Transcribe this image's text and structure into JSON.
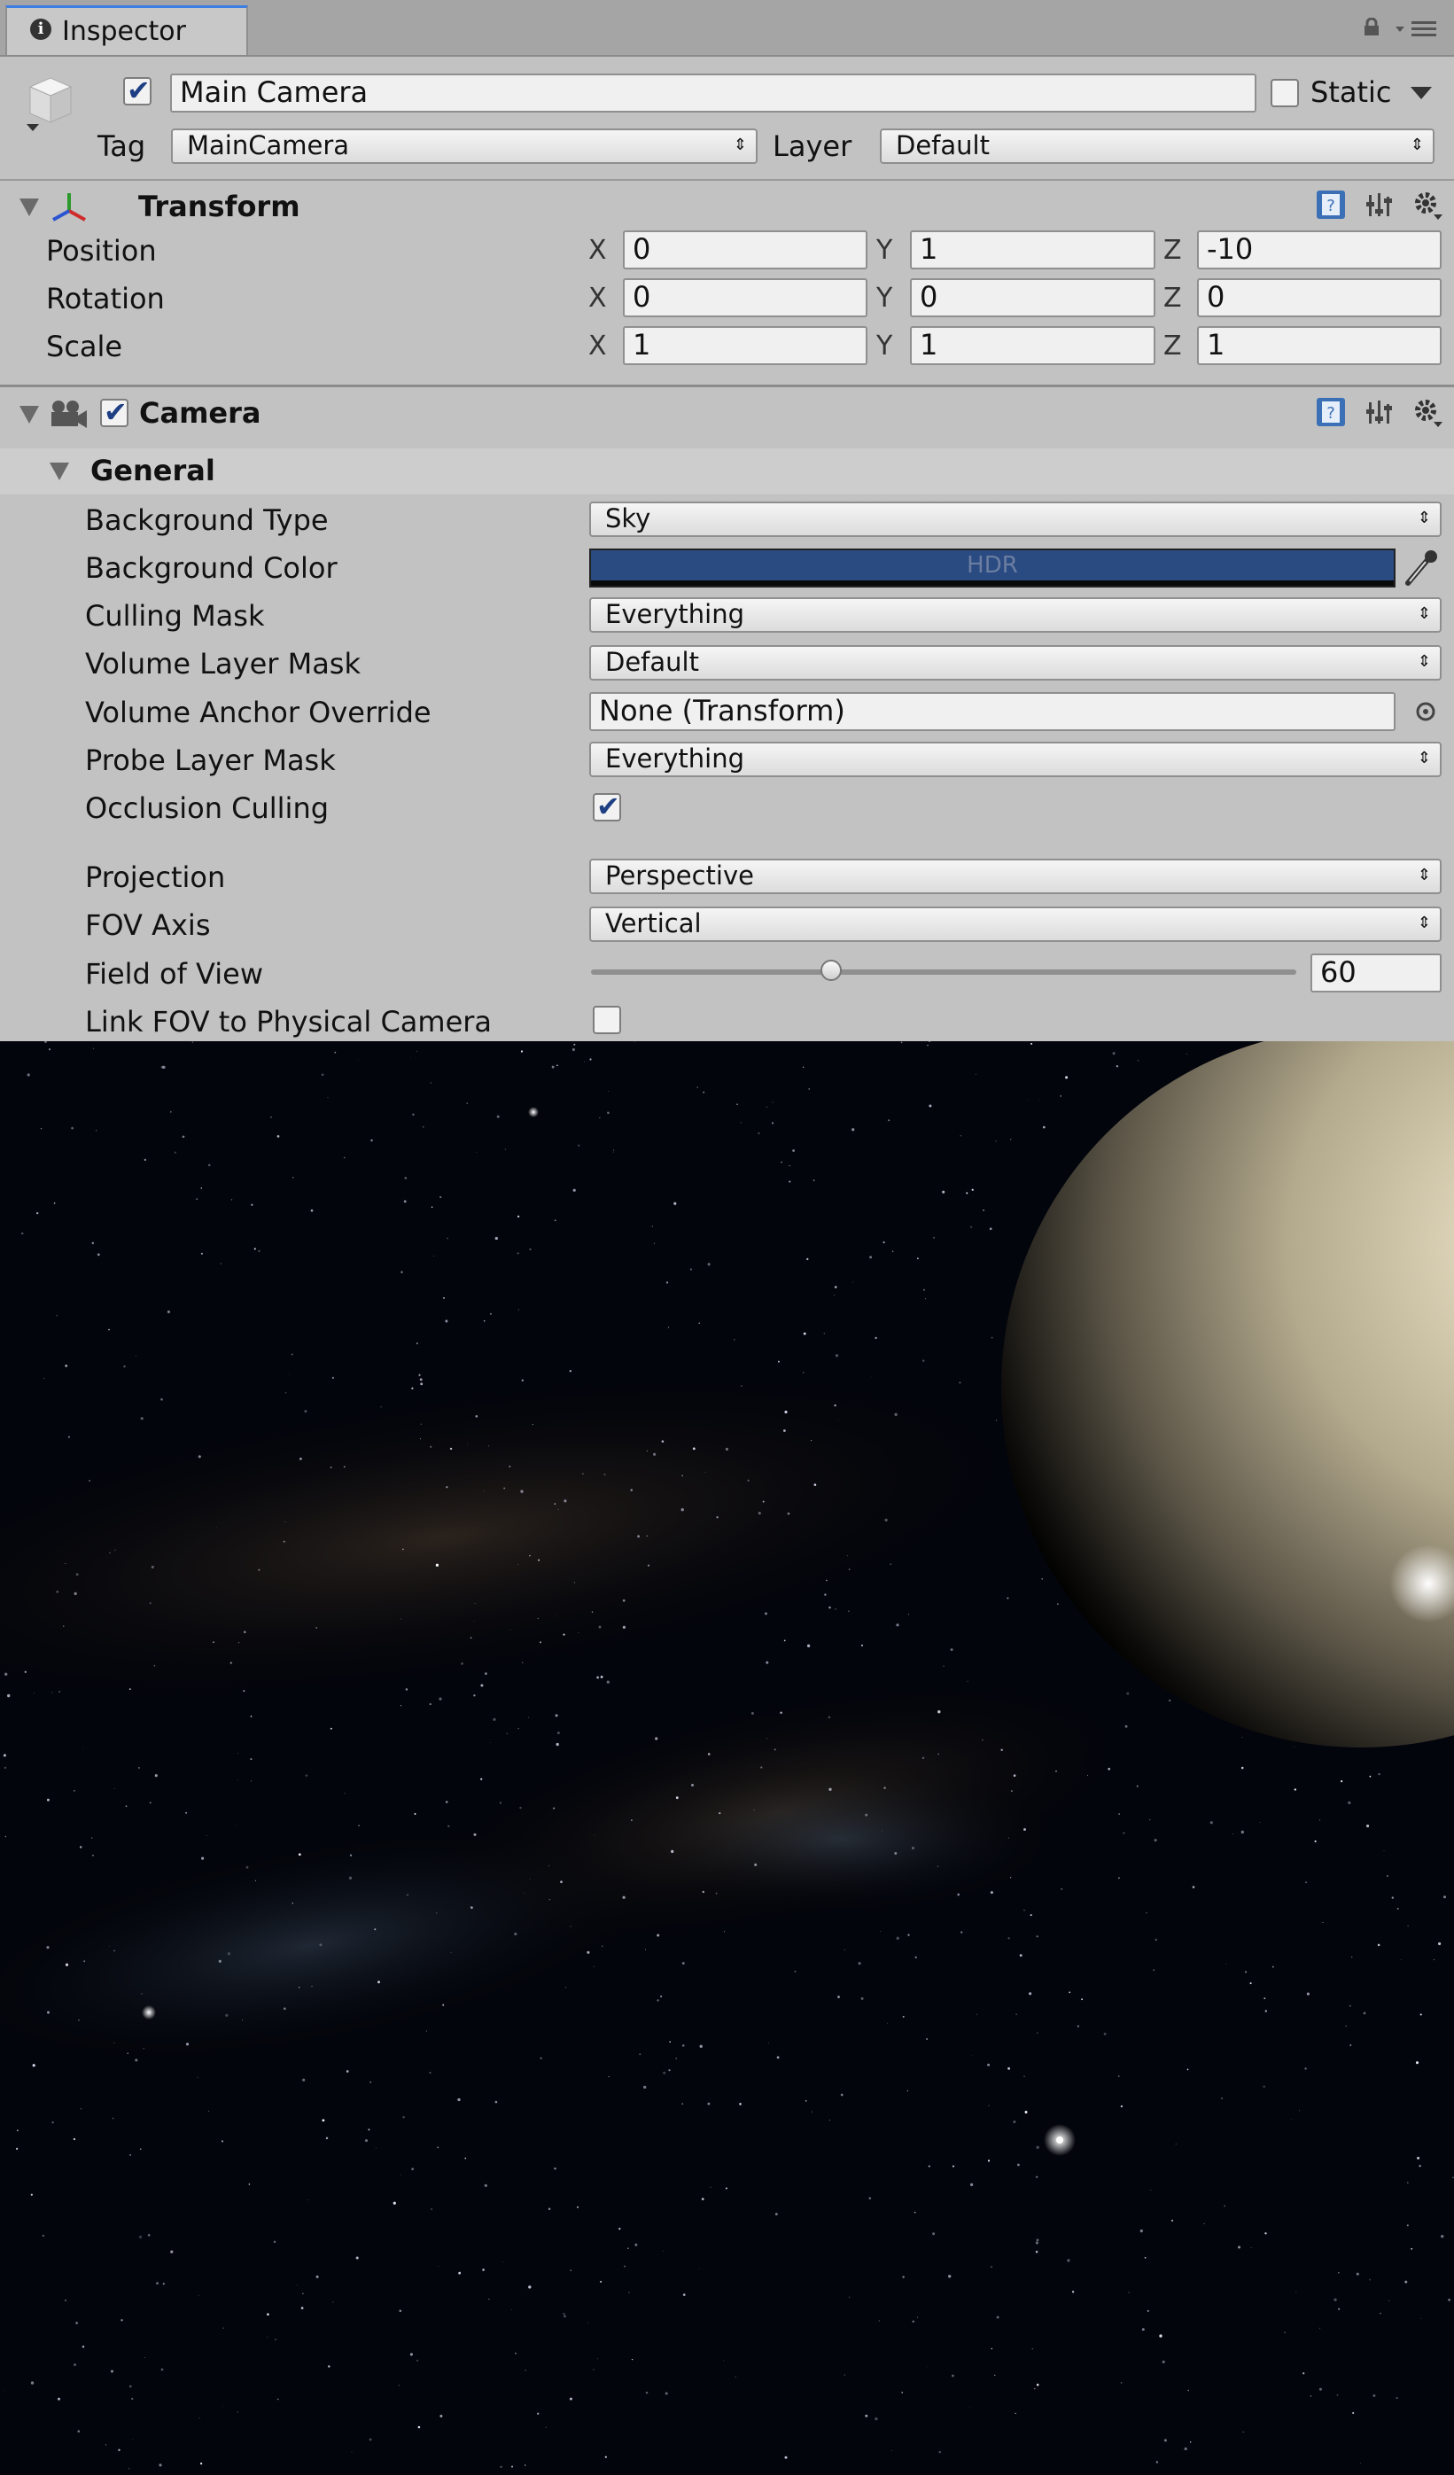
{
  "tab": {
    "title": "Inspector"
  },
  "gameobject": {
    "name": "Main Camera",
    "active": true,
    "static_label": "Static",
    "static": false,
    "tag_label": "Tag",
    "tag": "MainCamera",
    "layer_label": "Layer",
    "layer": "Default"
  },
  "transform": {
    "title": "Transform",
    "rows": [
      {
        "label": "Position",
        "x": "0",
        "y": "1",
        "z": "-10"
      },
      {
        "label": "Rotation",
        "x": "0",
        "y": "0",
        "z": "0"
      },
      {
        "label": "Scale",
        "x": "1",
        "y": "1",
        "z": "1"
      }
    ],
    "axis": {
      "x": "X",
      "y": "Y",
      "z": "Z"
    }
  },
  "camera": {
    "title": "Camera",
    "enabled": true,
    "general_label": "General",
    "properties": {
      "background_type": {
        "label": "Background Type",
        "value": "Sky"
      },
      "background_color": {
        "label": "Background Color",
        "value": "HDR",
        "color": "#2a4a82"
      },
      "culling_mask": {
        "label": "Culling Mask",
        "value": "Everything"
      },
      "volume_layer_mask": {
        "label": "Volume Layer Mask",
        "value": "Default"
      },
      "volume_anchor_override": {
        "label": "Volume Anchor Override",
        "value": "None (Transform)"
      },
      "probe_layer_mask": {
        "label": "Probe Layer Mask",
        "value": "Everything"
      },
      "occlusion_culling": {
        "label": "Occlusion Culling",
        "checked": true
      },
      "projection": {
        "label": "Projection",
        "value": "Perspective"
      },
      "fov_axis": {
        "label": "FOV Axis",
        "value": "Vertical"
      },
      "field_of_view": {
        "label": "Field of View",
        "value": "60",
        "slider_fraction": 0.34
      },
      "link_fov": {
        "label": "Link FOV to Physical Camera",
        "checked": false
      }
    }
  },
  "colors": {
    "panel_bg": "#c2c2c2",
    "accent_blue": "#3d7ee2",
    "hdr_swatch": "#2a4a82",
    "sphere": "#bcb296"
  }
}
